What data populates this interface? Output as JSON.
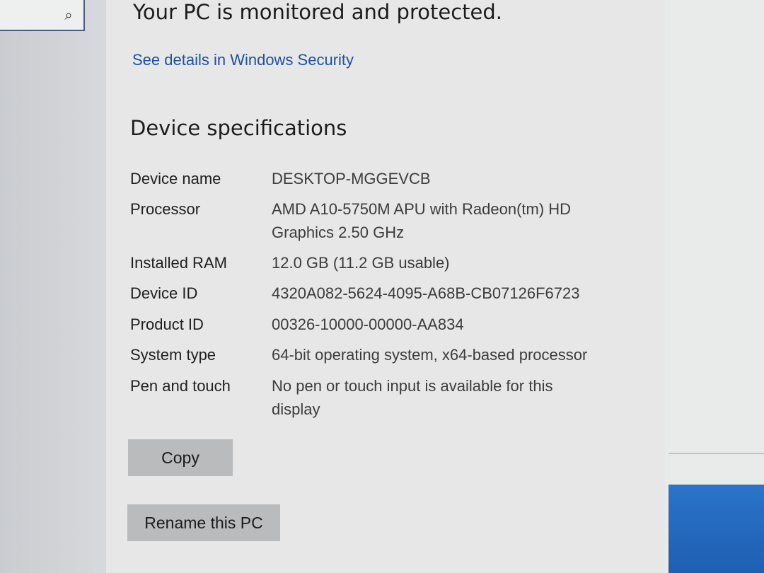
{
  "header": {
    "status_text": "Your PC is monitored and protected.",
    "details_link": "See details in Windows Security"
  },
  "device_specs": {
    "title": "Device specifications",
    "rows": [
      {
        "label": "Device name",
        "value": "DESKTOP-MGGEVCB"
      },
      {
        "label": "Processor",
        "value": "AMD A10-5750M APU with Radeon(tm) HD Graphics    2.50 GHz"
      },
      {
        "label": "Installed RAM",
        "value": "12.0 GB (11.2 GB usable)"
      },
      {
        "label": "Device ID",
        "value": "4320A082-5624-4095-A68B-CB07126F6723"
      },
      {
        "label": "Product ID",
        "value": "00326-10000-00000-AA834"
      },
      {
        "label": "System type",
        "value": "64-bit operating system, x64-based processor"
      },
      {
        "label": "Pen and touch",
        "value": "No pen or touch input is available for this display"
      }
    ]
  },
  "buttons": {
    "copy": "Copy",
    "rename": "Rename this PC"
  },
  "icons": {
    "search": "search-icon"
  },
  "colors": {
    "link": "#1d50a8",
    "taskbar_accent": "#2b74c9"
  }
}
